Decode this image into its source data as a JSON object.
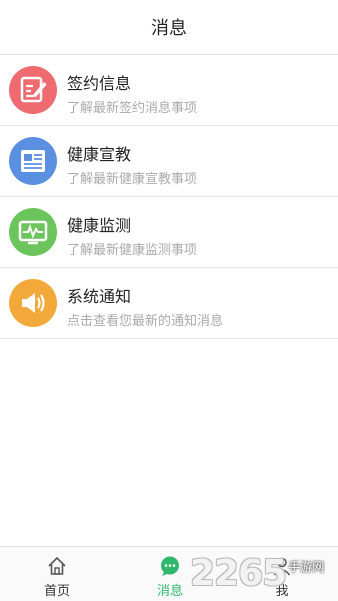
{
  "header": {
    "title": "消息"
  },
  "messages": [
    {
      "title": "签约信息",
      "subtitle": "了解最新签约消息事项",
      "icon": "sign-contract-icon",
      "color": "#ee6b6f"
    },
    {
      "title": "健康宣教",
      "subtitle": "了解最新健康宣教事项",
      "icon": "newspaper-icon",
      "color": "#5b8fe0"
    },
    {
      "title": "健康监测",
      "subtitle": "了解最新健康监测事项",
      "icon": "monitor-icon",
      "color": "#6cc45c"
    },
    {
      "title": "系统通知",
      "subtitle": "点击查看您最新的通知消息",
      "icon": "speaker-icon",
      "color": "#f2a93a"
    }
  ],
  "tabs": [
    {
      "label": "首页",
      "icon": "home-icon",
      "active": false
    },
    {
      "label": "消息",
      "icon": "chat-bubble-icon",
      "active": true
    },
    {
      "label": "我",
      "icon": "user-icon",
      "active": false
    }
  ],
  "watermark": {
    "number": "2265",
    "site": "手游网"
  },
  "colors": {
    "accent": "#2fb86b",
    "divider": "#e6e6e6"
  }
}
